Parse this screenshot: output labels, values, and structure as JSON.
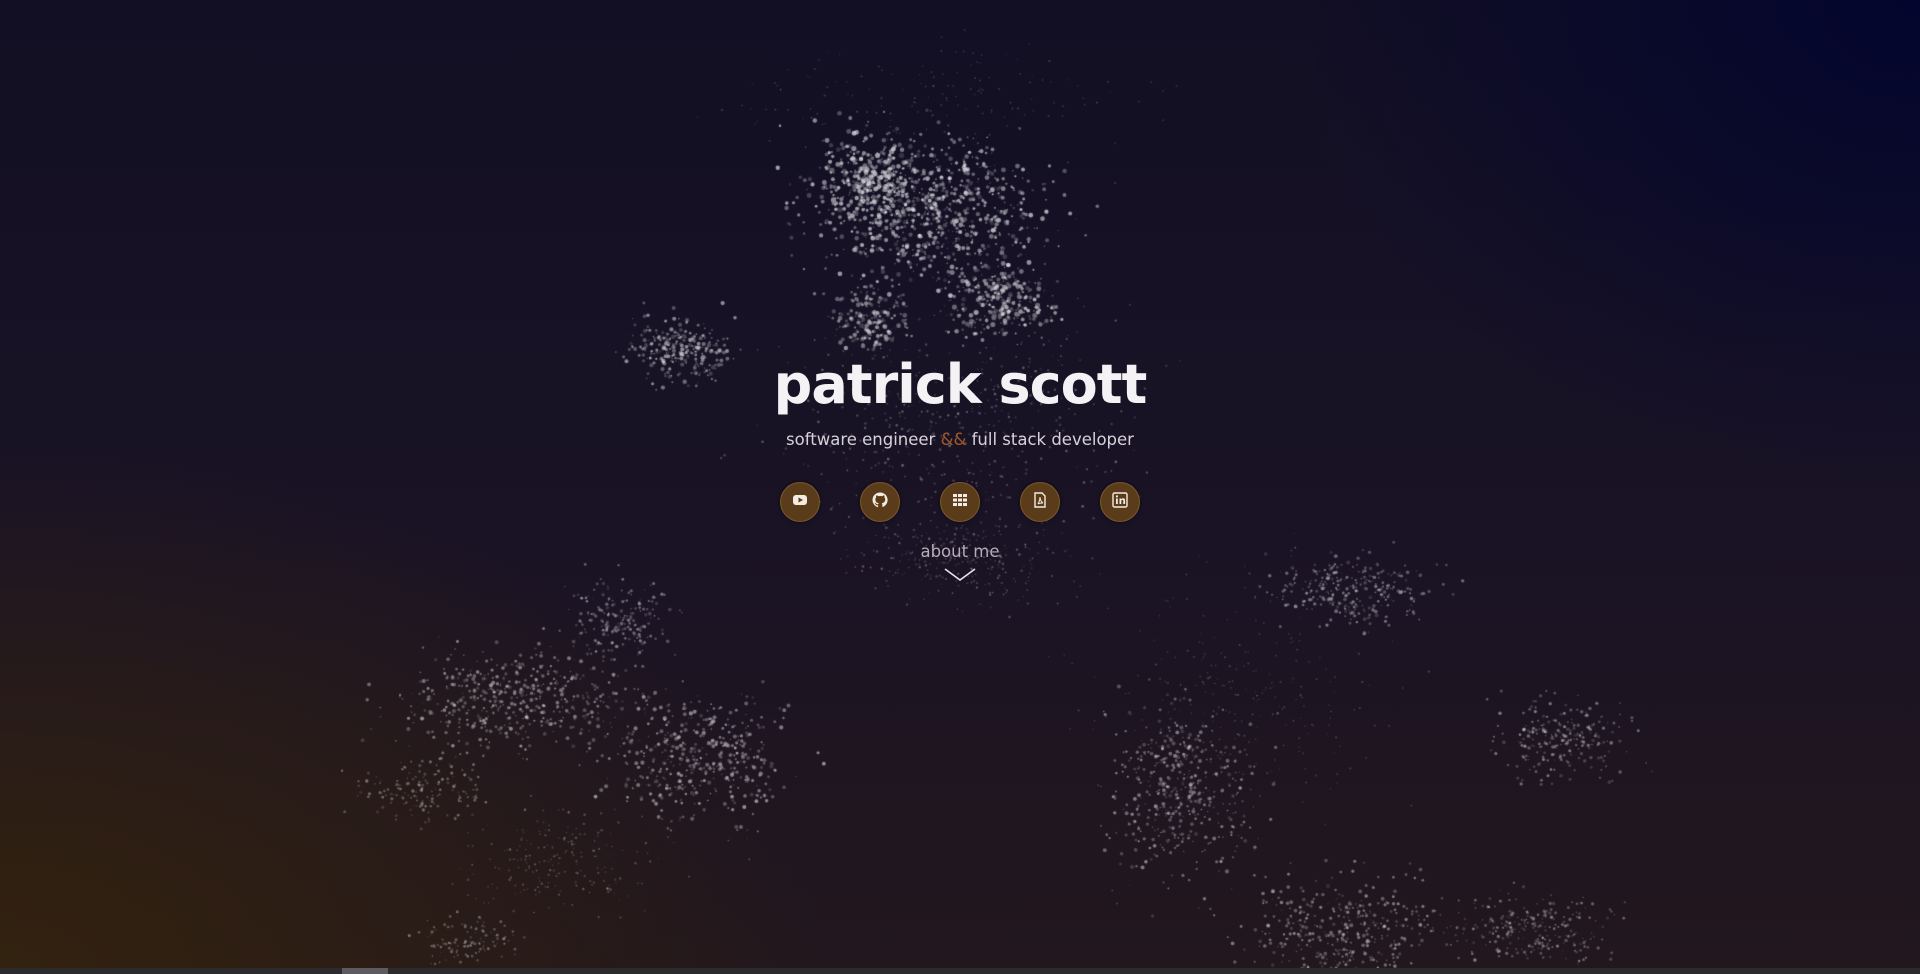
{
  "hero": {
    "name": "patrick scott",
    "tagline_part1": "software engineer",
    "tagline_amp": "&&",
    "tagline_part2": "full stack developer",
    "about_label": "about me"
  },
  "links": [
    {
      "icon": "youtube-icon"
    },
    {
      "icon": "github-icon"
    },
    {
      "icon": "grid-icon"
    },
    {
      "icon": "pdf-icon"
    },
    {
      "icon": "linkedin-icon"
    }
  ],
  "colors": {
    "accent": "#a3592a",
    "icon_bg": "#5b3c1a",
    "bg_top_right": "#03052e",
    "bg_bottom_left": "#33220f"
  }
}
